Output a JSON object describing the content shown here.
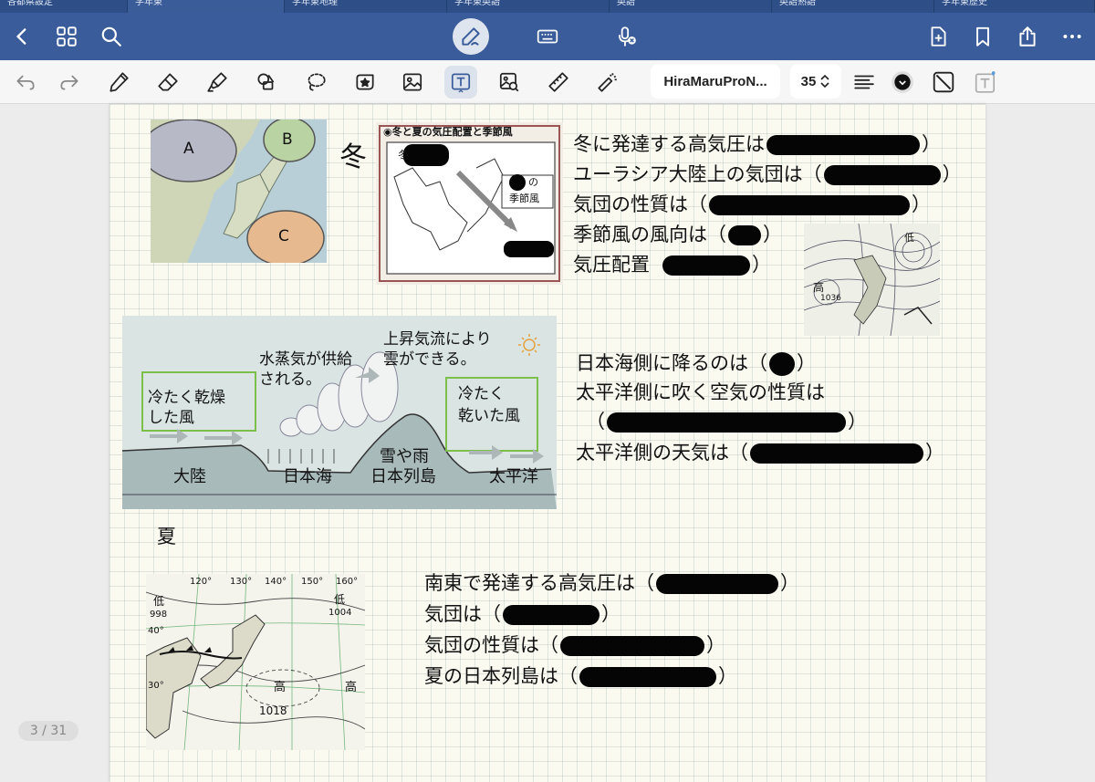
{
  "tabs": [
    "各都県設定",
    "学年東",
    "学年東地理",
    "学年東英語",
    "英語",
    "英語熟語",
    "学年東歴史"
  ],
  "toolbar": {
    "font_name": "HiraMaruProN...",
    "font_size": "35"
  },
  "page": {
    "indicator": "3 / 31",
    "winter": {
      "heading": "冬",
      "map_labels": [
        "A",
        "B",
        "C"
      ],
      "diagram_title": "◉冬と夏の気圧配置と季節風",
      "diagram_corner": "冬",
      "diagram_wind_label_top": "の",
      "diagram_wind_label_bottom": "季節風",
      "lines": [
        {
          "text": "冬に発達する高気圧は",
          "suffix": "）"
        },
        {
          "text": "ユーラシア大陸上の気団は（",
          "suffix": "）"
        },
        {
          "text": "気団の性質は（",
          "suffix": "）"
        },
        {
          "text": "季節風の風向は（",
          "suffix": "）"
        },
        {
          "text": "気圧配置",
          "suffix": "）"
        }
      ],
      "weather_map_labels": [
        "高",
        "1036",
        "低"
      ]
    },
    "cross_section": {
      "rising_air": "上昇気流により",
      "clouds_form": "雲ができる。",
      "vapor_1": "水蒸気が供給",
      "vapor_2": "される。",
      "cold_dry_1": "冷たく乾燥",
      "cold_dry_2": "した風",
      "cold_dry_right_1": "冷たく",
      "cold_dry_right_2": "乾いた風",
      "continent": "大陸",
      "sea_of_japan": "日本海",
      "snow_rain": "雪や雨",
      "archipelago": "日本列島",
      "pacific": "太平洋"
    },
    "cross_lines": [
      {
        "text": "日本海側に降るのは（",
        "suffix": "）"
      },
      {
        "text": "太平洋側に吹く空気の性質は",
        "suffix": ""
      },
      {
        "text": "（",
        "suffix": "）"
      },
      {
        "text": "太平洋側の天気は（",
        "suffix": "）"
      }
    ],
    "summer": {
      "heading": "夏",
      "map_labels": {
        "lon_120": "120°",
        "lon_130": "130°",
        "lon_140": "140°",
        "lon_150": "150°",
        "lon_160": "160°",
        "lat_40": "40°",
        "lat_30": "30°",
        "low_left": "低",
        "low_left_val": "998",
        "low_right": "低",
        "low_right_val": "1004",
        "high": "高",
        "high_val": "1018",
        "high_right": "高"
      },
      "lines": [
        {
          "text": "南東で発達する高気圧は（",
          "suffix": "）"
        },
        {
          "text": "気団は（",
          "suffix": "）"
        },
        {
          "text": "気団の性質は（",
          "suffix": "）"
        },
        {
          "text": "夏の日本列島は（",
          "suffix": "）"
        }
      ]
    }
  },
  "colors": {
    "nav_bg": "#3a5c9a",
    "tab_bg": "#2e4e87",
    "page_bg": "#fbfaf0",
    "accent": "#5a9bd8"
  }
}
